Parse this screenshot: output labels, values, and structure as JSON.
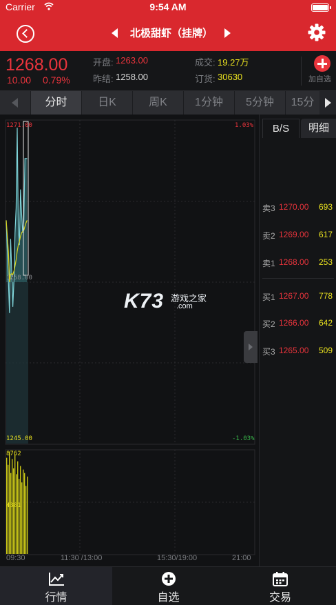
{
  "status_bar": {
    "carrier": "Carrier",
    "time": "9:54 AM"
  },
  "nav": {
    "title": "北极甜虾（挂牌）"
  },
  "quote": {
    "last_price": "1268.00",
    "change": "10.00",
    "change_pct": "0.79%",
    "open_label": "开盘:",
    "open_value": "1263.00",
    "prev_settle_label": "昨结:",
    "prev_settle_value": "1258.00",
    "volume_label": "成交:",
    "volume_value": "19.27万",
    "orders_label": "订货:",
    "orders_value": "30630",
    "add_watch_label": "加自选"
  },
  "tabs": [
    {
      "label": "分时",
      "active": true
    },
    {
      "label": "日K",
      "active": false
    },
    {
      "label": "周K",
      "active": false
    },
    {
      "label": "1分钟",
      "active": false
    },
    {
      "label": "5分钟",
      "active": false
    },
    {
      "label": "15分",
      "active": false
    }
  ],
  "chart_data": {
    "type": "line",
    "price_axis": {
      "max": "1271.00",
      "mid": "1258.00",
      "min": "1245.00"
    },
    "pct_axis": {
      "max": "1.03%",
      "min": "-1.03%"
    },
    "volume_axis": {
      "max": "8762",
      "mid": "4381"
    },
    "time_axis": [
      "09:30",
      "11:30 /13:00",
      "15:30/19:00",
      "21:00"
    ],
    "grid": true,
    "series": [
      {
        "values": [
          1263.0,
          1260.5,
          1258.0,
          1255.5,
          1261.5,
          1259.0,
          1256.0,
          1258.0,
          1262.0,
          1264.0,
          1270.5,
          1262.5,
          1261.0,
          1265.5,
          1263.5,
          1262.0,
          1263.0,
          1268.0,
          1268.0,
          1268.0
        ]
      },
      {
        "values": [
          1263.0,
          1261.8,
          1260.5,
          1258.0,
          1258.6,
          1258.7,
          1258.6,
          1258.9,
          1259.3,
          1259.8,
          1260.5,
          1261.0,
          1261.3,
          1261.7,
          1262.0,
          1262.1,
          1262.2,
          1262.5,
          1262.8,
          1263.0
        ]
      }
    ],
    "volume": [
      8200,
      7600,
      8700,
      6900,
      8100,
      7300,
      8500,
      6800,
      7900,
      6400,
      7500,
      6100,
      7200,
      6900,
      5800,
      6600
    ]
  },
  "order_book": {
    "tab_bs": "B/S",
    "tab_detail": "明细",
    "asks": [
      {
        "label": "卖3",
        "price": "1270.00",
        "volume": "693"
      },
      {
        "label": "卖2",
        "price": "1269.00",
        "volume": "617"
      },
      {
        "label": "卖1",
        "price": "1268.00",
        "volume": "253"
      }
    ],
    "bids": [
      {
        "label": "买1",
        "price": "1267.00",
        "volume": "778"
      },
      {
        "label": "买2",
        "price": "1266.00",
        "volume": "642"
      },
      {
        "label": "买3",
        "price": "1265.00",
        "volume": "509"
      }
    ]
  },
  "watermark": {
    "logo": "K73",
    "site_name": "游戏之家",
    "domain": ".com"
  },
  "tab_bar": [
    {
      "label": "行情",
      "icon": "chart-icon",
      "active": true
    },
    {
      "label": "自选",
      "icon": "plus-circle-icon",
      "active": false
    },
    {
      "label": "交易",
      "icon": "calendar-icon",
      "active": false
    }
  ],
  "colors": {
    "brand_red": "#d9282e",
    "up_red": "#e9343c",
    "volume_yellow": "#c9c617",
    "line_teal": "#7fd3d8",
    "avg_yellow": "#d7d31c"
  }
}
